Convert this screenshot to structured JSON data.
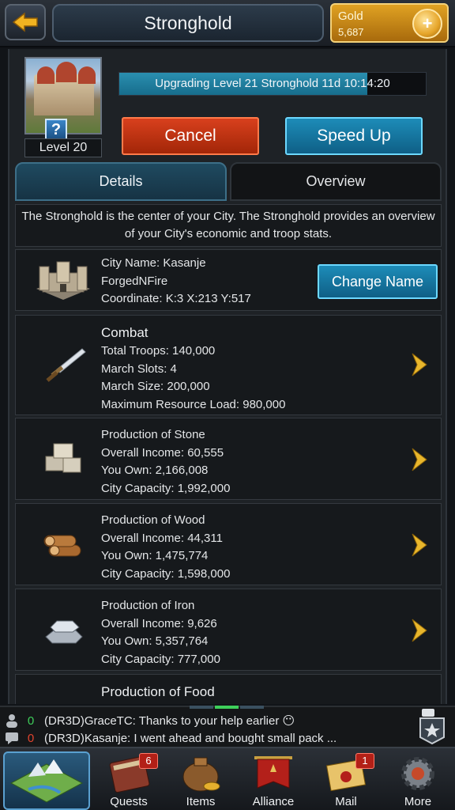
{
  "header": {
    "title": "Stronghold",
    "currency_label": "Gold",
    "currency_value": "5,687"
  },
  "building": {
    "level_label": "Level 20",
    "progress_text": "Upgrading Level 21 Stronghold 11d 10:14:20",
    "progress_fraction": 0.81
  },
  "actions": {
    "cancel_label": "Cancel",
    "speedup_label": "Speed Up"
  },
  "tabs": [
    {
      "label": "Details",
      "active": true
    },
    {
      "label": "Overview",
      "active": false
    }
  ],
  "description": "The Stronghold is the center of your City. The Stronghold provides an overview of your City's economic and troop stats.",
  "city": {
    "name_line": "City Name: Kasanje",
    "player_line": "ForgedNFire",
    "coordinate_line": "Coordinate: K:3 X:213 Y:517",
    "change_name_label": "Change Name"
  },
  "combat": {
    "heading": "Combat",
    "lines": [
      "Total Troops: 140,000",
      "March Slots: 4",
      "March Size: 200,000",
      "Maximum Resource Load: 980,000"
    ]
  },
  "stone": {
    "heading": "Production of Stone",
    "lines": [
      "Overall Income: 60,555",
      "You Own: 2,166,008",
      "City Capacity: 1,992,000"
    ]
  },
  "wood": {
    "heading": "Production of Wood",
    "lines": [
      "Overall Income: 44,311",
      "You Own: 1,475,774",
      "City Capacity: 1,598,000"
    ]
  },
  "iron": {
    "heading": "Production of Iron",
    "lines": [
      "Overall Income: 9,626",
      "You Own: 5,357,764",
      "City Capacity: 777,000"
    ]
  },
  "food": {
    "heading": "Production of Food"
  },
  "chat": {
    "rows": [
      {
        "count": "0",
        "count_color": "#3ecf5a",
        "text": "(DR3D)GraceTC: Thanks to your help earlier 😶"
      },
      {
        "count": "0",
        "count_color": "#e0442e",
        "text": "(DR3D)Kasanje: I went ahead and bought small pack ..."
      }
    ]
  },
  "nav": {
    "quests_label": "Quests",
    "quests_badge": "6",
    "items_label": "Items",
    "alliance_label": "Alliance",
    "mail_label": "Mail",
    "mail_badge": "1",
    "more_label": "More"
  },
  "icons": {
    "back": "back-arrow-icon",
    "gold": "gold-coin-icon",
    "help": "question-icon",
    "combat": "sword-icon",
    "stone": "stone-blocks-icon",
    "wood": "wood-logs-icon",
    "iron": "iron-ingots-icon",
    "city": "castle-icon",
    "arrow": "chevron-right-icon"
  },
  "colors": {
    "accent_blue": "#1d8cb8",
    "cancel_red": "#c8361a",
    "gold": "#e0a223",
    "chevron": "#e8b62c"
  }
}
